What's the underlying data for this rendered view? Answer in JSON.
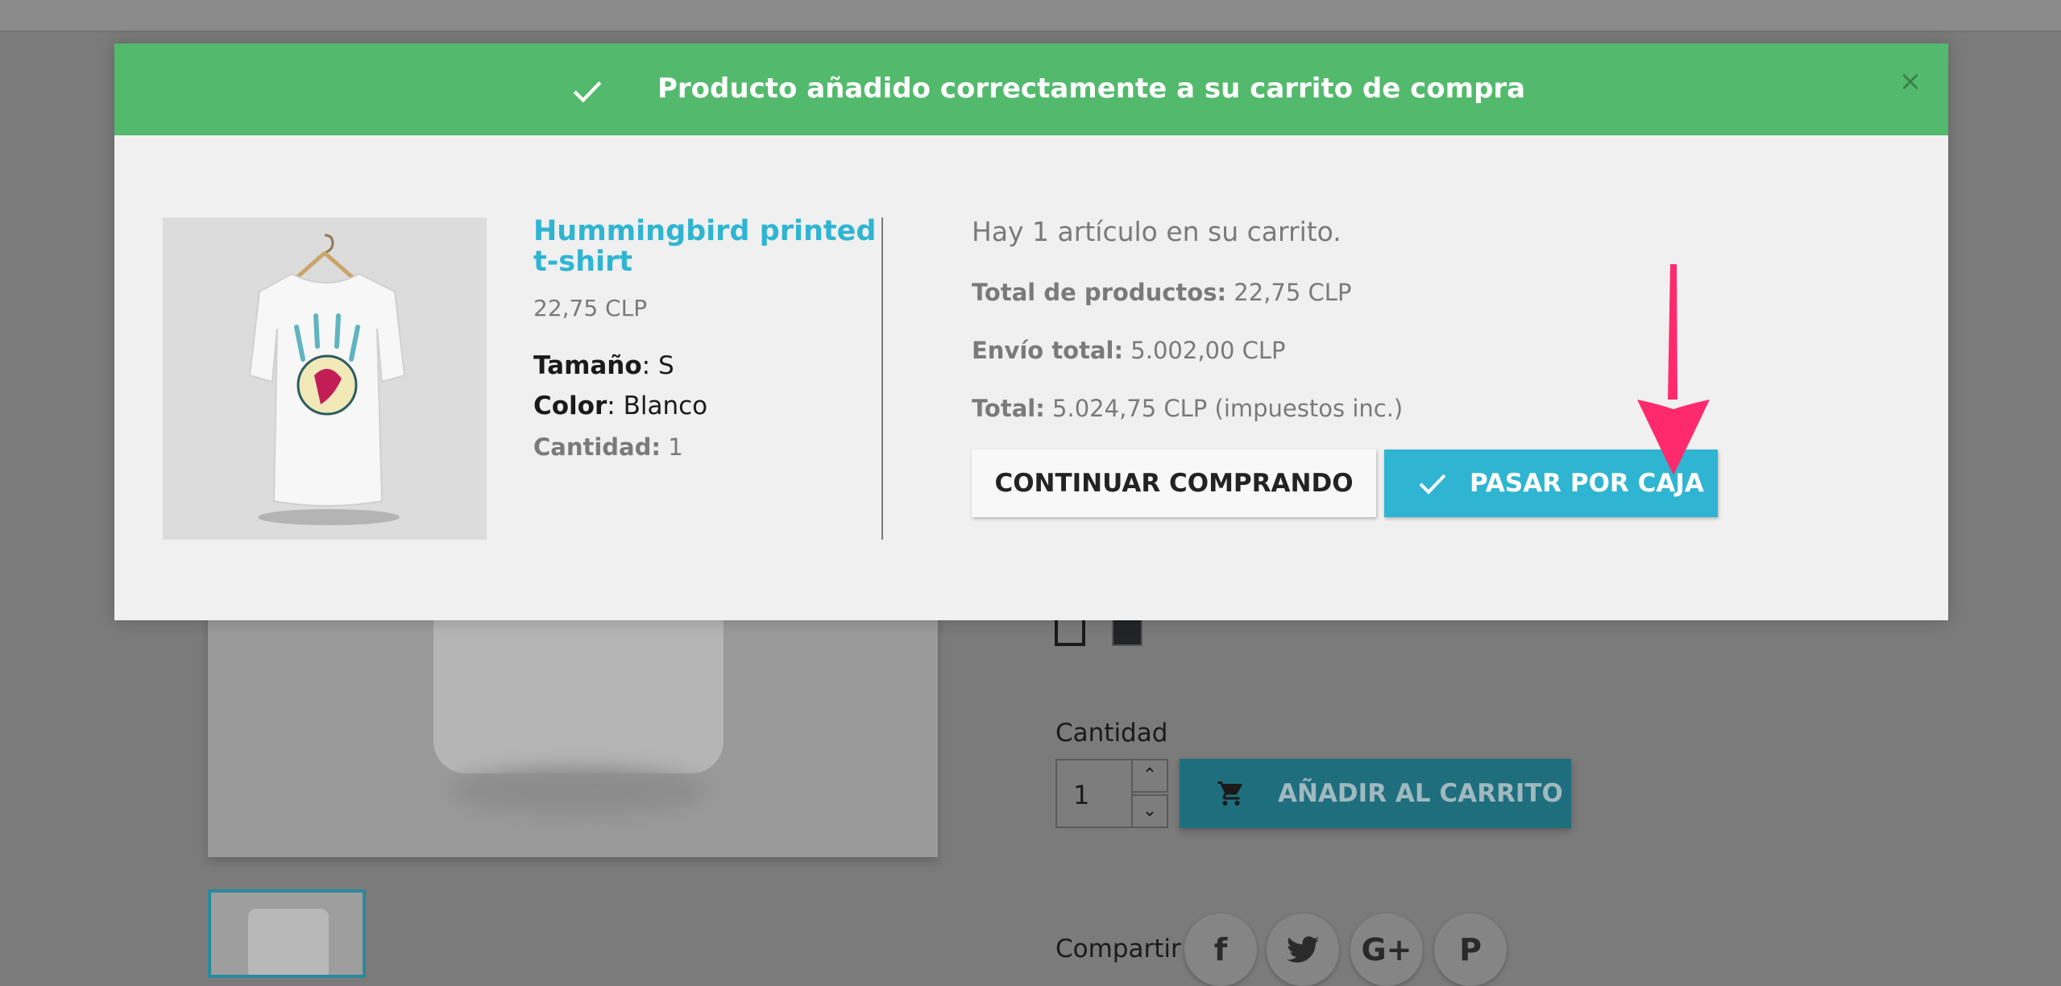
{
  "modal": {
    "header": {
      "title": "Producto añadido correctamente a su carrito de compra",
      "close_label": "×",
      "color": "#53ba6d"
    },
    "product": {
      "name": "Hummingbird printed t-shirt",
      "price": "22,75 CLP",
      "attributes": [
        {
          "label": "Tamaño",
          "value": "S"
        },
        {
          "label": "Color",
          "value": "Blanco"
        }
      ],
      "quantity_label": "Cantidad:",
      "quantity_value": "1"
    },
    "cart": {
      "count_text": "Hay 1 artículo en su carrito.",
      "subtotal_label": "Total de productos:",
      "subtotal_value": "22,75 CLP",
      "shipping_label": "Envío total:",
      "shipping_value": "5.002,00 CLP",
      "total_label": "Total:",
      "total_value": "5.024,75 CLP (impuestos inc.)"
    },
    "buttons": {
      "continue_label": "CONTINUAR COMPRANDO",
      "checkout_label": "PASAR POR CAJA"
    },
    "accent_color": "#2fb5d2",
    "annotation_arrow_color": "#ff2a6d"
  },
  "background": {
    "quantity_label": "Cantidad",
    "quantity_value": "1",
    "add_to_cart_label": "AÑADIR AL CARRITO",
    "share_label": "Compartir",
    "share_buttons": [
      "f",
      "t",
      "G+",
      "P"
    ],
    "swatches": [
      "white",
      "black"
    ]
  }
}
